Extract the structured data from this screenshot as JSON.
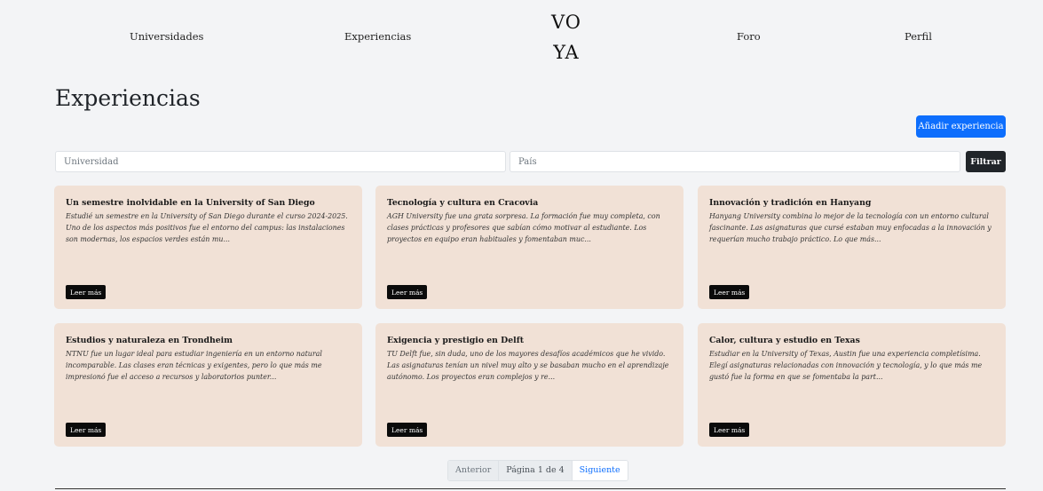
{
  "nav": {
    "links": [
      "Universidades",
      "Experiencias",
      "Foro",
      "Perfil"
    ],
    "logo_line1": "VO",
    "logo_line2": "YA"
  },
  "page": {
    "title": "Experiencias",
    "add_button": "Añadir experiencia"
  },
  "filter": {
    "university_placeholder": "Universidad",
    "country_placeholder": "País",
    "button": "Filtrar"
  },
  "cards": [
    {
      "title": "Un semestre inolvidable en la University of San Diego",
      "excerpt": "Estudié un semestre en la University of San Diego durante el curso 2024-2025. Uno de los aspectos más positivos fue el entorno del campus: las instalaciones son modernas, los espacios verdes están mu...",
      "button": "Leer más"
    },
    {
      "title": "Tecnología y cultura en Cracovia",
      "excerpt": "AGH University fue una grata sorpresa. La formación fue muy completa, con clases prácticas y profesores que sabían cómo motivar al estudiante. Los proyectos en equipo eran habituales y fomentaban muc...",
      "button": "Leer más"
    },
    {
      "title": "Innovación y tradición en Hanyang",
      "excerpt": "Hanyang University combina lo mejor de la tecnología con un entorno cultural fascinante. Las asignaturas que cursé estaban muy enfocadas a la innovación y requerían mucho trabajo práctico. Lo que más...",
      "button": "Leer más"
    },
    {
      "title": "Estudios y naturaleza en Trondheim",
      "excerpt": "NTNU fue un lugar ideal para estudiar ingeniería en un entorno natural incomparable. Las clases eran técnicas y exigentes, pero lo que más me impresionó fue el acceso a recursos y laboratorios punter...",
      "button": "Leer más"
    },
    {
      "title": "Exigencia y prestigio en Delft",
      "excerpt": "TU Delft fue, sin duda, uno de los mayores desafíos académicos que he vivido. Las asignaturas tenían un nivel muy alto y se basaban mucho en el aprendizaje autónomo. Los proyectos eran complejos y re...",
      "button": "Leer más"
    },
    {
      "title": "Calor, cultura y estudio en Texas",
      "excerpt": "Estudiar en la University of Texas, Austin fue una experiencia completísima. Elegí asignaturas relacionadas con innovación y tecnología, y lo que más me gustó fue la forma en que se fomentaba la part...",
      "button": "Leer más"
    }
  ],
  "pagination": {
    "previous": "Anterior",
    "info": "Página 1 de 4",
    "next": "Siguiente"
  },
  "colors": {
    "background": "#f3f4f6",
    "card": "#f1e1d6",
    "primary": "#0d6efd",
    "dark": "#212529"
  }
}
